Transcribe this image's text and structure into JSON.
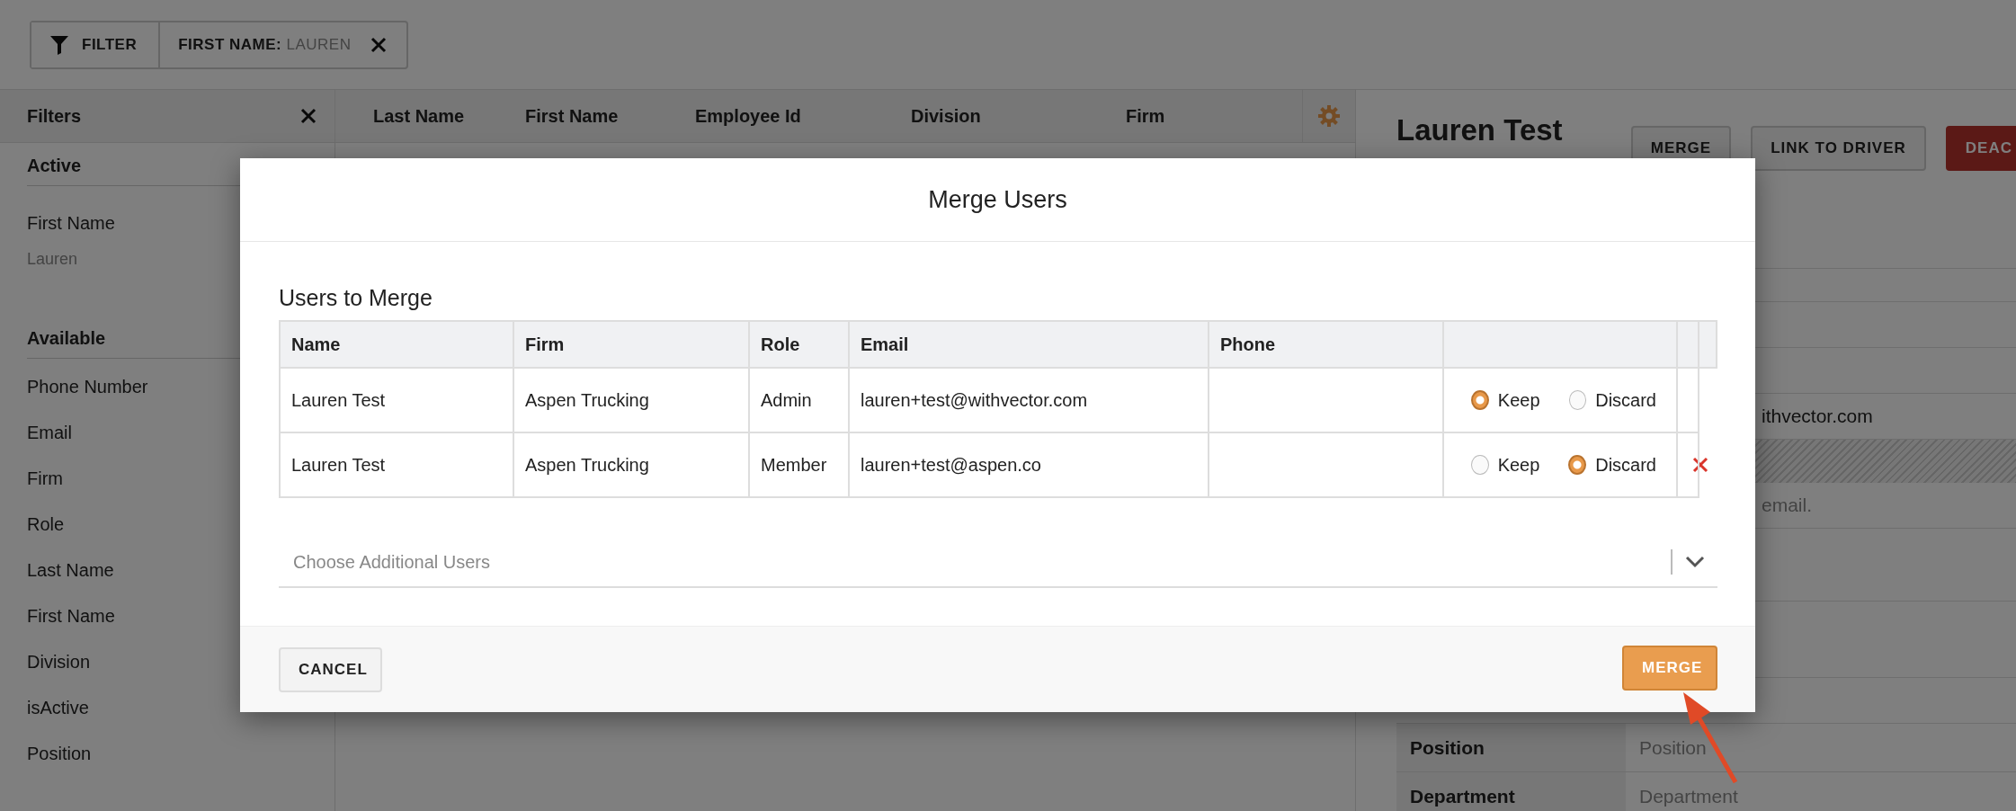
{
  "filter_bar": {
    "filter_button": "FILTER",
    "chips": [
      {
        "label": "FIRST NAME:",
        "value": "LAUREN"
      }
    ]
  },
  "sidebar": {
    "title": "Filters",
    "active": {
      "heading": "Active",
      "items": [
        {
          "label": "First Name",
          "value": "Lauren"
        }
      ]
    },
    "available": {
      "heading": "Available",
      "items": [
        "Phone Number",
        "Email",
        "Firm",
        "Role",
        "Last Name",
        "First Name",
        "Division",
        "isActive",
        "Position"
      ]
    }
  },
  "grid": {
    "columns": [
      "Last Name",
      "First Name",
      "Employee Id",
      "Division",
      "Firm"
    ]
  },
  "detail": {
    "title": "Lauren Test",
    "buttons": [
      {
        "label": "MERGE",
        "kind": "default"
      },
      {
        "label": "LINK TO DRIVER",
        "kind": "default"
      },
      {
        "label": "DEAC",
        "kind": "danger"
      }
    ],
    "email_value": "ithvector.com",
    "email_hint": "email.",
    "rows": [
      {
        "label": "Position",
        "value": "Position"
      },
      {
        "label": "Department",
        "value": "Department"
      }
    ]
  },
  "modal": {
    "title": "Merge Users",
    "section_title": "Users to Merge",
    "columns": [
      "Name",
      "Firm",
      "Role",
      "Email",
      "Phone"
    ],
    "rows": [
      {
        "name": "Lauren Test",
        "firm": "Aspen Trucking",
        "role": "Admin",
        "email": "lauren+test@withvector.com",
        "removable": false,
        "options": [
          {
            "label": "Keep",
            "selected": true
          },
          {
            "label": "Discard",
            "selected": false
          }
        ]
      },
      {
        "name": "Lauren Test",
        "firm": "Aspen Trucking",
        "role": "Member",
        "email": "lauren+test@aspen.co",
        "removable": true,
        "options": [
          {
            "label": "Keep",
            "selected": false
          },
          {
            "label": "Discard",
            "selected": true
          }
        ]
      }
    ],
    "picker": {
      "placeholder": "Choose Additional Users"
    },
    "buttons": [
      {
        "label": "CANCEL",
        "kind": "secondary"
      },
      {
        "label": "MERGE",
        "kind": "primary"
      }
    ]
  }
}
